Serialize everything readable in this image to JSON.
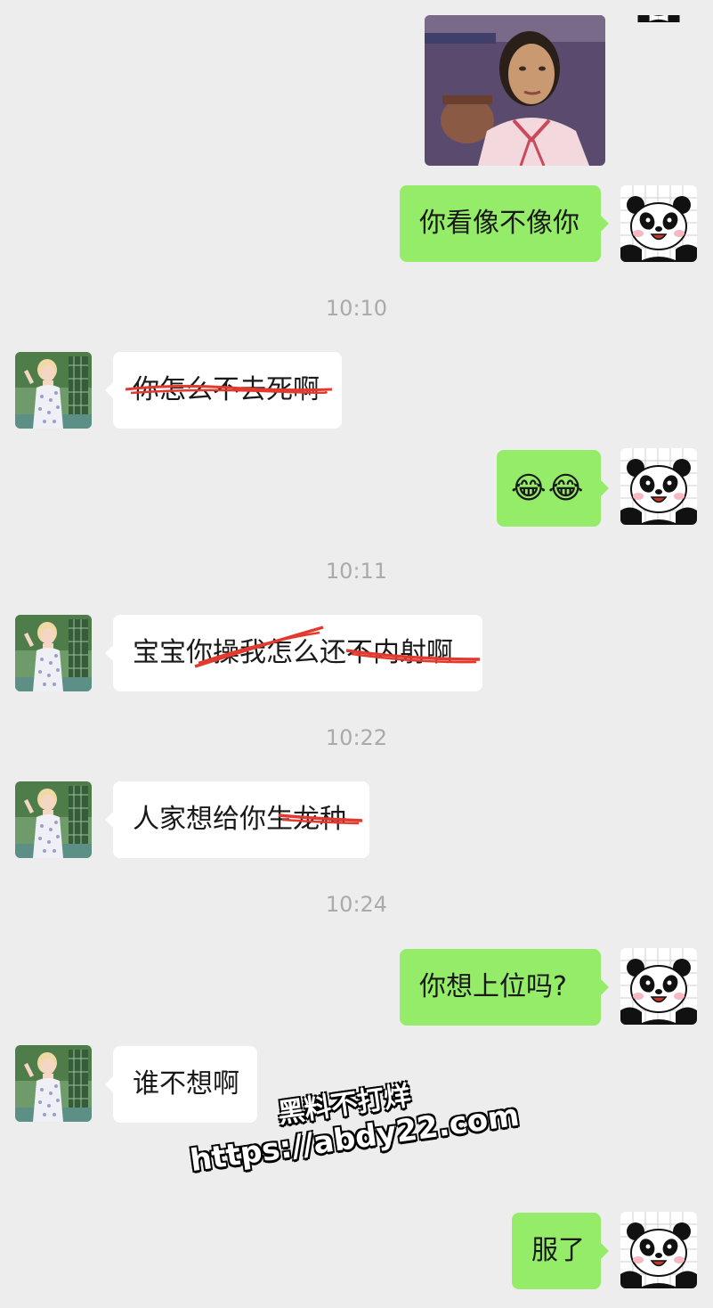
{
  "messages": [
    {
      "id": "m1",
      "type": "image",
      "sender": "self",
      "alt": ""
    },
    {
      "id": "m2",
      "type": "text",
      "sender": "self",
      "text": "你看像不像你"
    },
    {
      "id": "t1",
      "type": "time",
      "text": "10:10"
    },
    {
      "id": "m3",
      "type": "text",
      "sender": "other",
      "text": "你怎么不去死啊",
      "struck": true
    },
    {
      "id": "m4",
      "type": "emoji",
      "sender": "self",
      "text": "😂😂"
    },
    {
      "id": "t2",
      "type": "time",
      "text": "10:11"
    },
    {
      "id": "m5",
      "type": "text",
      "sender": "other",
      "text": "宝宝你操我怎么还不内射啊",
      "struck": true
    },
    {
      "id": "t3",
      "type": "time",
      "text": "10:22"
    },
    {
      "id": "m6",
      "type": "text",
      "sender": "other",
      "text": "人家想给你生龙种",
      "struck": true
    },
    {
      "id": "t4",
      "type": "time",
      "text": "10:24"
    },
    {
      "id": "m7",
      "type": "text",
      "sender": "self",
      "text": "你想上位吗?"
    },
    {
      "id": "m8",
      "type": "text",
      "sender": "other",
      "text": "谁不想啊"
    },
    {
      "id": "m9",
      "type": "text",
      "sender": "self",
      "text": "服了"
    }
  ],
  "watermark": {
    "line1": "黑料不打烊",
    "line2": "https://abdy22.com"
  },
  "colors": {
    "background": "#ededed",
    "bubble_self": "#95ec69",
    "bubble_other": "#ffffff",
    "strike": "#e23a2e",
    "timestamp": "#aaaaaa"
  },
  "icons": {
    "self_avatar": "panda-avatar-icon",
    "other_avatar": "girl-photo-avatar",
    "emoji": "tears-of-joy-emoji"
  }
}
